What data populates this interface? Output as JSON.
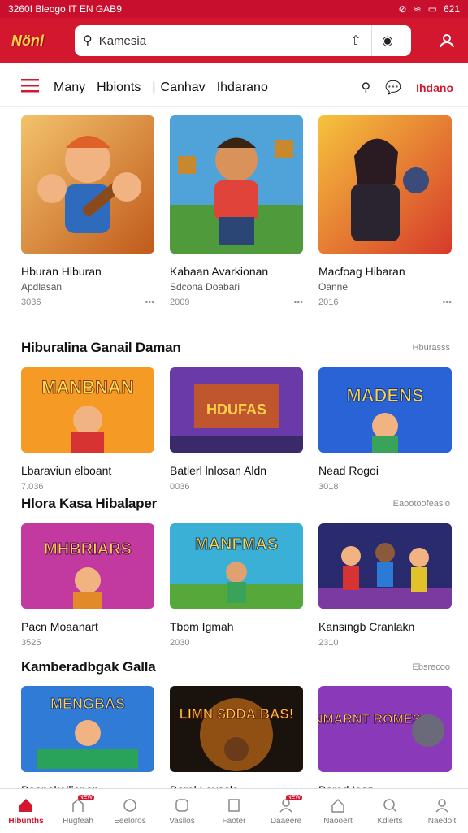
{
  "status": {
    "time": "3260I Bleogo IT EN GAB9",
    "battery": "621"
  },
  "topbar": {
    "logo": "Nönl",
    "search_value": "Kamesia"
  },
  "nav": {
    "tabs": [
      "Many",
      "Hbionts",
      "Canhav",
      "Ihdarano"
    ],
    "hot": "Ihdano"
  },
  "row1": [
    {
      "title": "Hburan Hiburan",
      "sub": "Apdlasan",
      "rating": "3036"
    },
    {
      "title": "Kabaan Avarkionan",
      "sub": "Sdcona Doabari",
      "rating": "2009"
    },
    {
      "title": "Macfoag Hibaran",
      "sub": "Oanne",
      "rating": "2016"
    }
  ],
  "sec1": {
    "title": "Hiburalina Ganail Daman",
    "more": "Hburasss"
  },
  "row2": [
    {
      "title": "Lbaraviun elboant",
      "rating": "7.036",
      "art": "MANBNAN"
    },
    {
      "title": "Batlerl lnlosan Aldn",
      "rating": "0036",
      "art": "HDUFAS"
    },
    {
      "title": "Nead Rogoi",
      "rating": "3018",
      "art": "MADENS"
    }
  ],
  "sec2": {
    "title": "Hlora Kasa Hibalaper",
    "more": "Eaootoofeasio"
  },
  "row3": [
    {
      "title": "Pacn Moaanart",
      "rating": "3525",
      "art": "MHBRIARS"
    },
    {
      "title": "Tbom Igmah",
      "rating": "2030",
      "art": "MANFMAS"
    },
    {
      "title": "Kansingb Cranlakn",
      "rating": "2310",
      "art": ""
    }
  ],
  "sec3": {
    "title": "Kamberadbgak Galla",
    "more": "Ebsrecoo"
  },
  "row4": [
    {
      "title": "Baanakellionan",
      "art": "MENGBAS"
    },
    {
      "title": "Barol Lavasla",
      "art": "LIMN SDDAIBAS!"
    },
    {
      "title": "Bared Iean",
      "art": "NMARNT ROMES"
    }
  ],
  "bottom": [
    "Hibunths",
    "Hugfeah",
    "Eeeloros",
    "Vasilos",
    "Faoter",
    "Daaeere",
    "Naooert",
    "Kdlerts",
    "Naedoit"
  ],
  "colors": {
    "brand": "#d3172f"
  }
}
